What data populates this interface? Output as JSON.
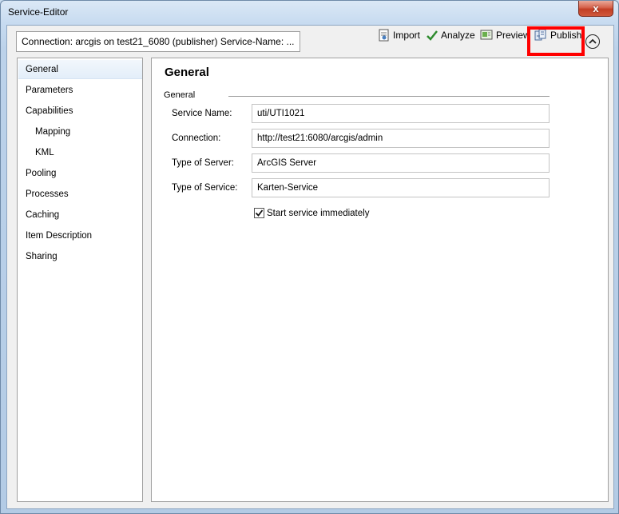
{
  "window": {
    "title": "Service-Editor",
    "close_label": "x"
  },
  "connection_summary": "Connection: arcgis on  test21_6080 (publisher)   Service-Name: ...",
  "toolbar": {
    "import_label": "Import",
    "analyze_label": "Analyze",
    "preview_label": "Preview",
    "publish_label": "Publish"
  },
  "sidebar": {
    "items": [
      {
        "label": "General"
      },
      {
        "label": "Parameters"
      },
      {
        "label": "Capabilities"
      },
      {
        "label": "Mapping"
      },
      {
        "label": "KML"
      },
      {
        "label": "Pooling"
      },
      {
        "label": "Processes"
      },
      {
        "label": "Caching"
      },
      {
        "label": "Item Description"
      },
      {
        "label": "Sharing"
      }
    ],
    "selected": "General"
  },
  "main": {
    "title": "General",
    "group_label": "General",
    "fields": {
      "service_name": {
        "label": "Service Name:",
        "value": "uti/UTI1021"
      },
      "connection": {
        "label": "Connection:",
        "value": "http://test21:6080/arcgis/admin"
      },
      "server_type": {
        "label": "Type of Server:",
        "value": "ArcGIS Server"
      },
      "service_type": {
        "label": "Type of Service:",
        "value": "Karten-Service"
      }
    },
    "start_immediately": {
      "label": "Start service immediately",
      "checked": true
    }
  },
  "colors": {
    "highlight": "#ff0000",
    "analyze_check": "#2e8b2e"
  }
}
